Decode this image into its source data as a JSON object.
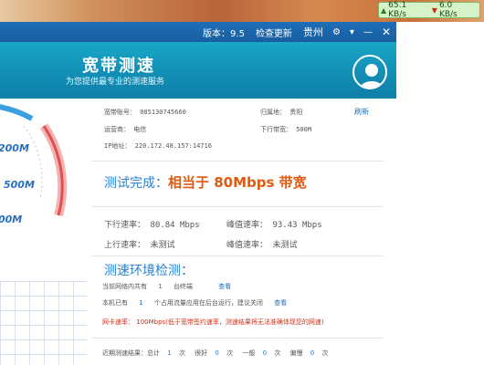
{
  "taskbar": {
    "upload_speed": "65.1 KB/s",
    "download_speed": "6.0 KB/s"
  },
  "titlebar": {
    "version": "版本：9.5",
    "check_update": "检查更新",
    "city": "贵州"
  },
  "header": {
    "title": "宽带测速",
    "subtitle": "为您提供最专业的测速服务"
  },
  "gauge": {
    "labels": [
      "200M",
      "500M",
      "00M"
    ]
  },
  "account": {
    "broadband_label": "宽带账号：",
    "broadband_value": "085130745660",
    "location_label": "归属地：",
    "location_value": "贵阳",
    "refresh": "刷新",
    "isp_label": "运营商：",
    "isp_value": "电信",
    "bandwidth_label": "下行带宽：",
    "bandwidth_value": "500M",
    "ip_label": "IP地址：",
    "ip_value": "220.172.48.157:14716"
  },
  "result": {
    "label": "测试完成：",
    "value": "相当于 80Mbps 带宽"
  },
  "speeds": {
    "down_label": "下行速率：",
    "down_value": "80.84 Mbps",
    "down_peak_label": "峰值速率：",
    "down_peak_value": "93.43 Mbps",
    "up_label": "上行速率：",
    "up_value": "未测试",
    "up_peak_label": "峰值速率：",
    "up_peak_value": "未测试"
  },
  "env": {
    "title": "测速环境检测：",
    "lan_prefix": "当前网络内共有",
    "lan_count": "1",
    "lan_suffix": "台终端",
    "view1": "查看",
    "bg_prefix": "本机已有",
    "bg_count": "1",
    "bg_suffix": "个占用流量应用在后台运行，建议关闭",
    "view2": "查看",
    "nic_label": "网卡速率：",
    "nic_warning": "100Mbps(低于宽带签约速率，测速结果将无法准确体现您的网速)"
  },
  "history": {
    "label": "近期测速结果：总计",
    "total": "1",
    "unit1": "次",
    "good_label": "很好",
    "good": "0",
    "unit2": "次",
    "normal_label": "一般",
    "normal": "0",
    "unit3": "次",
    "slow_label": "偏慢",
    "slow": "0",
    "unit4": "次"
  }
}
